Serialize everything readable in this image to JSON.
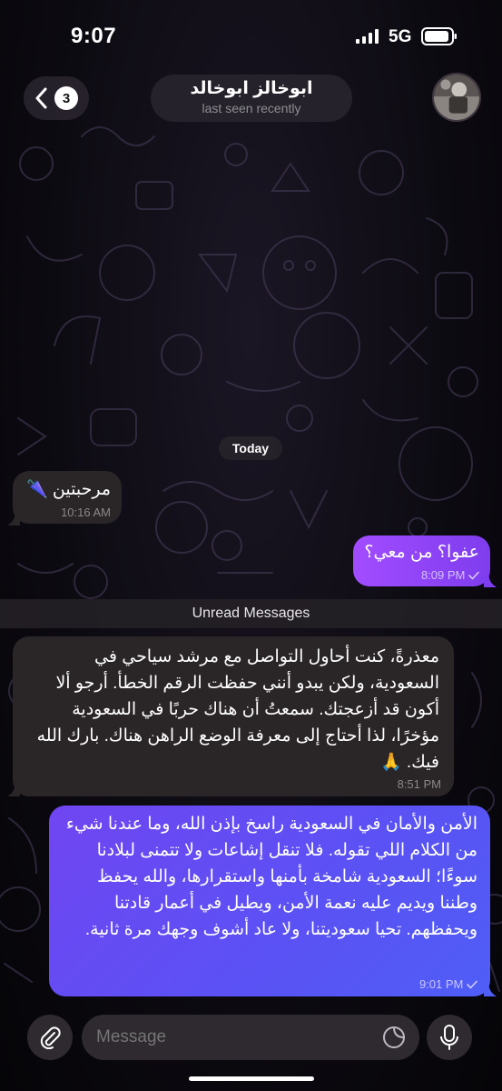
{
  "status_bar": {
    "time": "9:07",
    "network": "5G"
  },
  "header": {
    "unread_count": "3",
    "contact_name": "ابوخالز ابوخالد",
    "last_seen": "last seen recently"
  },
  "chat": {
    "date_label": "Today",
    "unread_divider": "Unread Messages",
    "messages": [
      {
        "direction": "incoming",
        "text": "مرحبتين 🌂",
        "time": "10:16 AM"
      },
      {
        "direction": "outgoing",
        "text": "عفوا؟ من معي؟",
        "time": "8:09 PM",
        "status": "read-single-check"
      },
      {
        "direction": "incoming",
        "text": "معذرةً، كنت أحاول التواصل مع مرشد سياحي في السعودية، ولكن يبدو أنني حفظت الرقم الخطأ. أرجو ألا أكون قد أزعجتك. سمعتُ أن هناك حربًا في السعودية مؤخرًا، لذا أحتاج إلى معرفة الوضع الراهن هناك. بارك الله فيك. 🙏",
        "time": "8:51 PM"
      },
      {
        "direction": "outgoing",
        "text": "الأمن والأمان في السعودية راسخ بإذن الله، وما عندنا شيء من الكلام اللي تقوله. فلا تنقل إشاعات ولا تتمنى لبلادنا سوءًا؛ السعودية شامخة بأمنها واستقرارها، والله يحفظ وطننا ويديم عليه نعمة الأمن، ويطيل في أعمار قادتنا ويحفظهم. تحيا سعوديتنا، ولا عاد أشوف وجهك مرة ثانية.",
        "time": "9:01 PM",
        "status": "read-single-check"
      }
    ]
  },
  "composer": {
    "placeholder": "Message"
  },
  "colors": {
    "outgoing_bubble": "#7e3dee",
    "outgoing_bubble_long": "#5a52f4",
    "incoming_bubble": "#2a2527"
  },
  "icons": [
    "back-chevron-icon",
    "attach-icon",
    "sticker-icon",
    "mic-icon",
    "check-icon",
    "signal-icon",
    "battery-icon"
  ]
}
